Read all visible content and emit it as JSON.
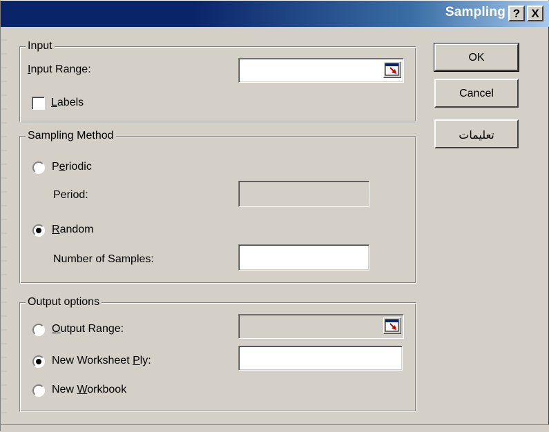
{
  "window": {
    "title": "Sampling",
    "help_glyph": "?",
    "close_glyph": "X"
  },
  "input_group": {
    "legend": "Input",
    "input_range_label": "Input Range:",
    "input_range_value": "",
    "labels_checkbox_label": "Labels",
    "labels_checked": false
  },
  "sampling_group": {
    "legend": "Sampling Method",
    "periodic_label": "Periodic",
    "periodic_selected": false,
    "period_label": "Period:",
    "period_value": "",
    "random_label": "Random",
    "random_selected": true,
    "num_samples_label": "Number of Samples:",
    "num_samples_value": ""
  },
  "output_group": {
    "legend": "Output options",
    "output_range_label": "Output Range:",
    "output_range_selected": false,
    "output_range_value": "",
    "new_worksheet_label": "New Worksheet Ply:",
    "new_worksheet_selected": true,
    "new_worksheet_value": "",
    "new_workbook_label": "New Workbook",
    "new_workbook_selected": false
  },
  "buttons": {
    "ok": "OK",
    "cancel": "Cancel",
    "help": "تعليمات"
  },
  "icons": {
    "range_selector": "range-selector-icon"
  }
}
